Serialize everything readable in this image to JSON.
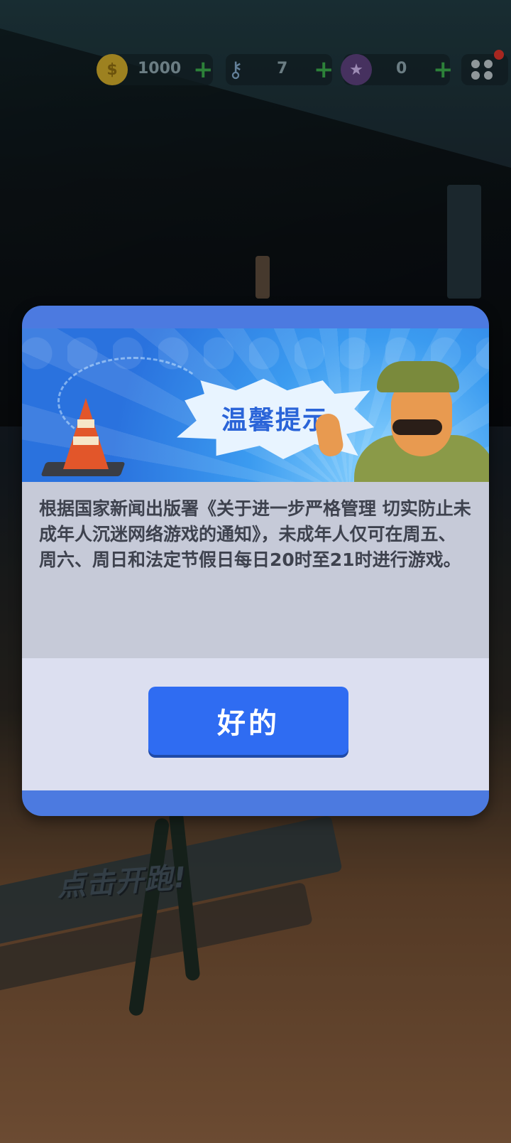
{
  "hud": {
    "coins": "1000",
    "keys": "7",
    "tokens": "0",
    "plus": "+"
  },
  "background": {
    "tap_hint": "点击开跑!"
  },
  "dialog": {
    "title": "温馨提示",
    "message": "根据国家新闻出版署《关于进一步严格管理 切实防止未成年人沉迷网络游戏的通知》，未成年人仅可在周五、周六、周日和法定节假日每日20时至21时进行游戏。",
    "ok_label": "好的"
  },
  "colors": {
    "accent_blue": "#2f6cf2",
    "dialog_frame": "#4c7ae0",
    "plus_green": "#3aa64a",
    "notification_red": "#d8322a"
  },
  "icons": {
    "coin": "coin-icon",
    "key": "key-icon",
    "token": "token-icon",
    "menu": "menu-grid-icon"
  }
}
